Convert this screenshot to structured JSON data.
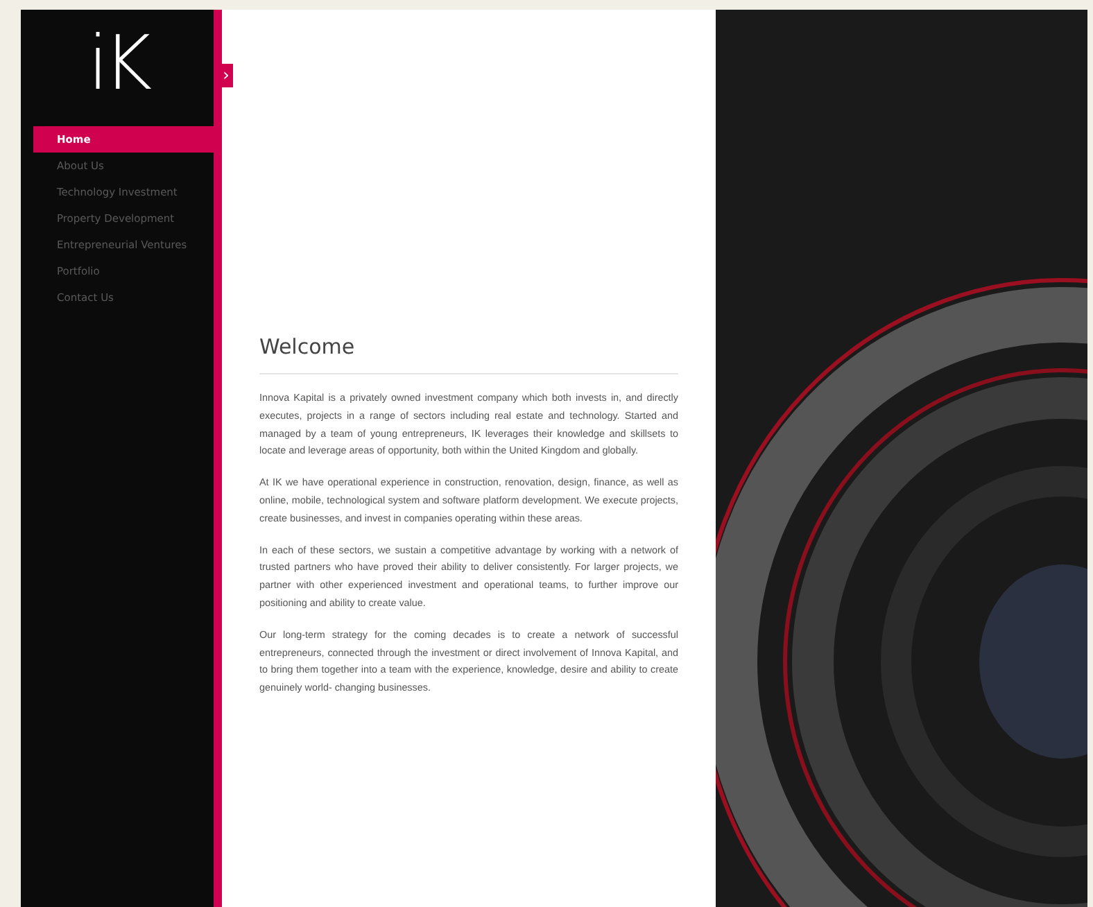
{
  "logo": "iK",
  "nav": [
    {
      "label": "Home",
      "selected": true
    },
    {
      "label": "About Us",
      "selected": false
    },
    {
      "label": "Technology Investment",
      "selected": false
    },
    {
      "label": "Property Development",
      "selected": false
    },
    {
      "label": "Entrepreneurial Ventures",
      "selected": false
    },
    {
      "label": "Portfolio",
      "selected": false
    },
    {
      "label": "Contact Us",
      "selected": false
    }
  ],
  "toggle": "›",
  "heading": "Welcome",
  "paragraphs": [
    "Innova Kapital is a privately owned investment company which both invests in, and directly executes, projects in a range of sectors including real estate and technology. Started and managed by a team of young entrepreneurs, IK leverages their knowledge and skillsets to locate and leverage areas of opportunity, both within the United Kingdom and globally.",
    "At IK we have operational experience in construction, renovation, design, finance, as well as online, mobile, technological system and software platform development. We execute projects, create businesses, and invest in companies operating within these areas.",
    "In each of these sectors, we sustain a competitive advantage by working with a network of trusted partners who have proved their ability to deliver consistently. For larger projects, we partner with other experienced investment and operational teams, to further improve our positioning and ability to create value.",
    "Our long-term strategy for the coming decades is to create a network of successful entrepreneurs, connected through the investment or direct involvement of Innova Kapital, and to bring them together into a team with the experience, knowledge, desire and ability to create genuinely world- changing businesses."
  ]
}
